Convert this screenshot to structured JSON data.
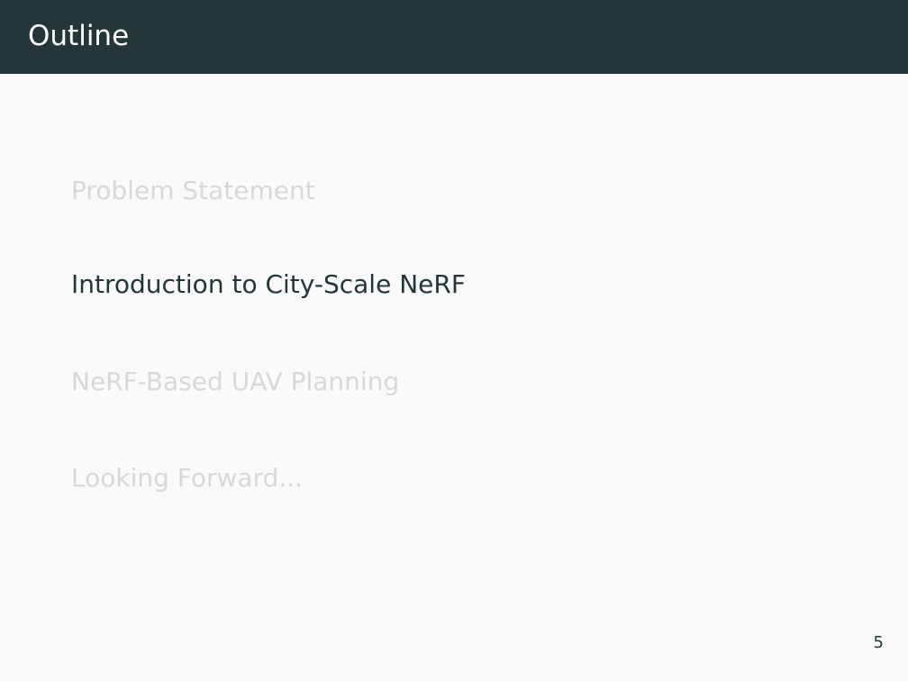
{
  "slide": {
    "title": "Outline",
    "page_number": "5",
    "outline_items": [
      {
        "label": "Problem Statement",
        "state": "inactive"
      },
      {
        "label": "Introduction to City-Scale NeRF",
        "state": "active"
      },
      {
        "label": "NeRF-Based UAV Planning",
        "state": "inactive"
      },
      {
        "label": "Looking Forward...",
        "state": "inactive"
      }
    ]
  },
  "colors": {
    "title_bar_background": "#23373b",
    "title_text": "#ffffff",
    "active_item_text": "#23373b",
    "inactive_item_text": "#d8d8d8",
    "slide_background": "#fafafa"
  }
}
